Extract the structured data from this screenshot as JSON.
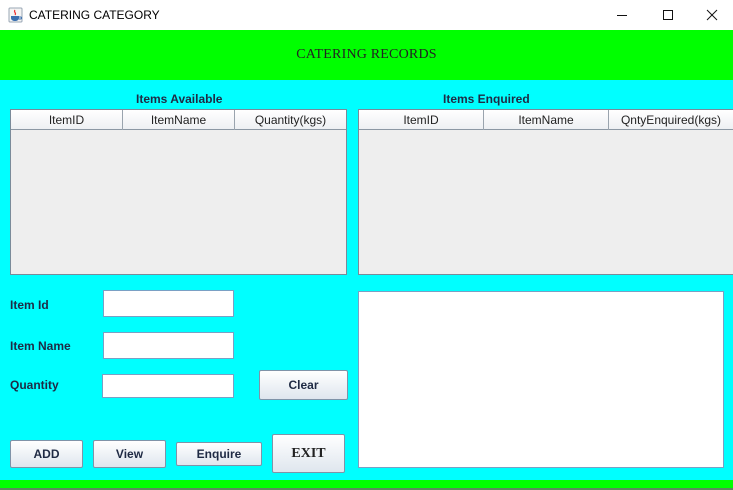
{
  "window": {
    "title": "CATERING CATEGORY",
    "icon": "java-cup-icon",
    "controls": [
      "minimize-icon",
      "maximize-icon",
      "close-icon"
    ]
  },
  "header": {
    "text": "CATERING RECORDS",
    "color": "#00ff00"
  },
  "colors": {
    "content_bg": "#00ffff",
    "header_bg": "#00ff00",
    "table_bg": "#eeeeee"
  },
  "available": {
    "title": "Items Available",
    "columns": [
      "ItemID",
      "ItemName",
      "Quantity(kgs)"
    ],
    "rows": []
  },
  "enquired": {
    "title": "Items Enquired",
    "columns": [
      "ItemID",
      "ItemName",
      "QntyEnquired(kgs)"
    ],
    "rows": []
  },
  "form": {
    "item_id_label": "Item Id",
    "item_id_value": "",
    "item_name_label": "Item Name",
    "item_name_value": "",
    "quantity_label": "Quantity",
    "quantity_value": ""
  },
  "buttons": {
    "clear": "Clear",
    "add": "ADD",
    "view": "View",
    "enquire": "Enquire",
    "exit": "EXIT"
  },
  "output": {
    "value": ""
  }
}
